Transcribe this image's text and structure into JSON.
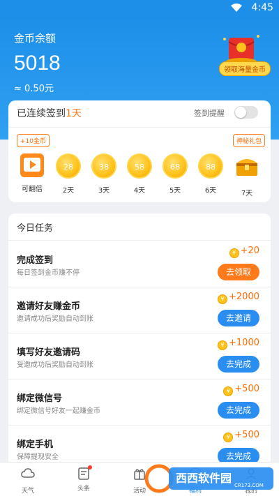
{
  "status_bar": {
    "time": "4:45"
  },
  "header": {
    "title": "金币余额",
    "balance": "5018",
    "approx": "≈ 0.50元",
    "reward_label": "领取海量金币"
  },
  "signin": {
    "prefix": "已连续签到",
    "days": "1天",
    "remind_label": "签到提醒",
    "bubble_left": "+10金币",
    "bubble_right": "神秘礼包",
    "items": [
      {
        "label": "可翻倍",
        "icon": "video-icon"
      },
      {
        "label": "2天",
        "value": "28"
      },
      {
        "label": "3天",
        "value": "38"
      },
      {
        "label": "4天",
        "value": "58"
      },
      {
        "label": "5天",
        "value": "68"
      },
      {
        "label": "6天",
        "value": "88"
      },
      {
        "label": "7天",
        "icon": "treasure-chest-icon"
      }
    ]
  },
  "tasks": {
    "title": "今日任务",
    "items": [
      {
        "name": "完成签到",
        "desc": "每日签到金币赚不停",
        "reward": "+20",
        "button": "去领取",
        "color": "#ff7a1a"
      },
      {
        "name": "邀请好友赚金币",
        "desc": "邀请成功后奖励自动到账",
        "reward": "+2000",
        "button": "去邀请",
        "color": "#2a8ef0"
      },
      {
        "name": "填写好友邀请码",
        "desc": "受邀成功后奖励自动到账",
        "reward": "+1000",
        "button": "去完成",
        "color": "#2a8ef0"
      },
      {
        "name": "绑定微信号",
        "desc": "绑定微信号好友一起赚金币",
        "reward": "+500",
        "button": "去完成",
        "color": "#2a8ef0"
      },
      {
        "name": "绑定手机",
        "desc": "保障提现安全",
        "reward": "+500",
        "button": "去完成",
        "color": "#2a8ef0"
      }
    ]
  },
  "tabbar": {
    "items": [
      {
        "label": "天气",
        "icon": "cloud-icon"
      },
      {
        "label": "头条",
        "icon": "news-icon"
      },
      {
        "label": "活动",
        "icon": "gift-icon"
      },
      {
        "label": "福利",
        "icon": "welfare-icon"
      },
      {
        "label": "我的",
        "icon": "user-icon"
      }
    ]
  },
  "watermark": {
    "text1": "西西软件园",
    "text2": "CR173.COM"
  },
  "colors": {
    "primary": "#1e8fe8",
    "accent": "#ff7a1a"
  }
}
